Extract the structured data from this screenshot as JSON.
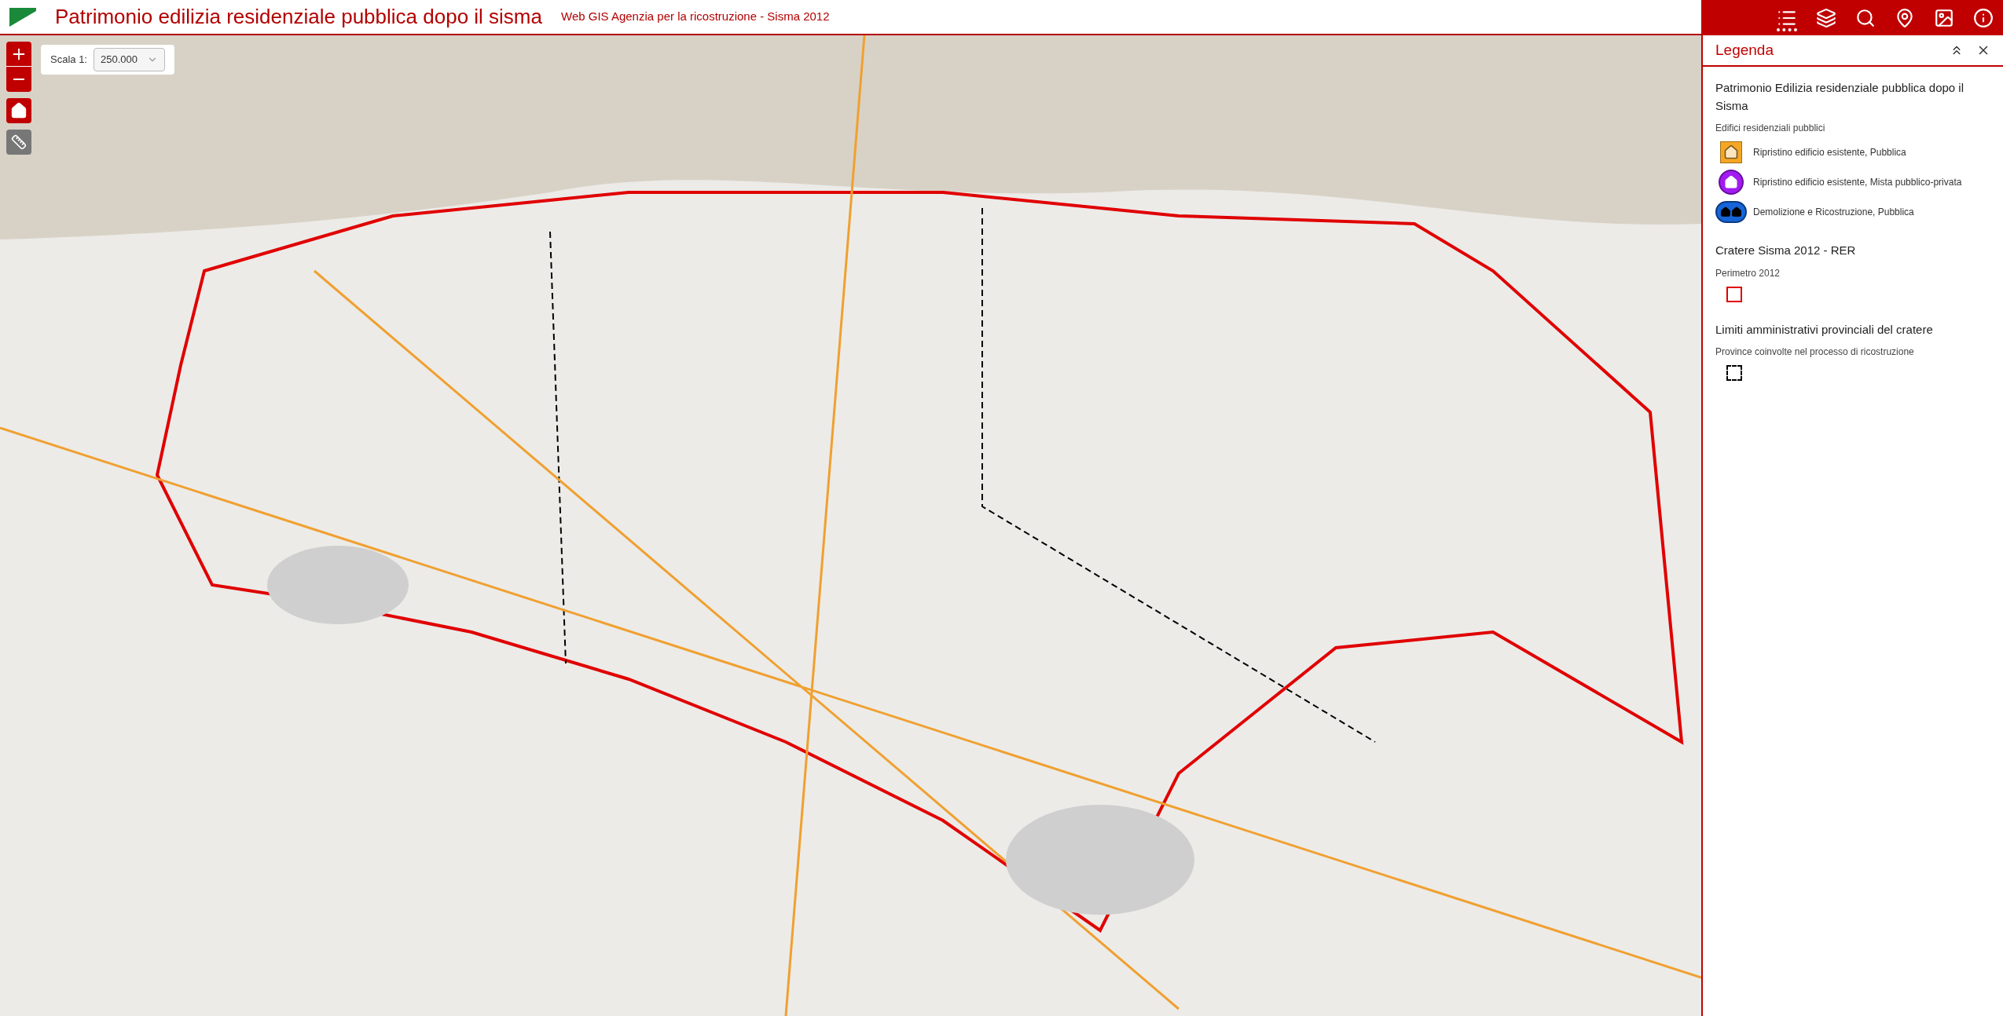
{
  "header": {
    "title": "Patrimonio edilizia residenziale pubblica dopo il sisma",
    "subtitle": "Web GIS Agenzia per la ricostruzione - Sisma 2012"
  },
  "toolbar": [
    {
      "kind": "legend",
      "selected": true
    },
    {
      "kind": "layers",
      "selected": false
    },
    {
      "kind": "search",
      "selected": false
    },
    {
      "kind": "location",
      "selected": false
    },
    {
      "kind": "image",
      "selected": false
    },
    {
      "kind": "info",
      "selected": false
    }
  ],
  "scale": {
    "label": "Scala 1:",
    "value": "250.000"
  },
  "panel": {
    "title": "Legenda",
    "sections": [
      {
        "title": "Patrimonio Edilizia residenziale pubblica dopo il Sisma",
        "subtitle": "Edifici residenziali pubblici",
        "items": [
          {
            "kind": "square-house",
            "label": "Ripristino edificio esistente, Pubblica"
          },
          {
            "kind": "circle-house",
            "label": "Ripristino edificio esistente, Mista pubblico-privata"
          },
          {
            "kind": "ellipse-houses",
            "label": "Demolizione e Ricostruzione, Pubblica"
          }
        ]
      },
      {
        "title": "Cratere Sisma 2012 - RER",
        "subtitle": "Perimetro 2012",
        "items": [
          {
            "kind": "red-outline"
          }
        ]
      },
      {
        "title": "Limiti amministrativi provinciali del cratere",
        "subtitle": "Province coinvolte nel processo di ricostruzione",
        "items": [
          {
            "kind": "dashed-outline"
          }
        ]
      }
    ]
  }
}
